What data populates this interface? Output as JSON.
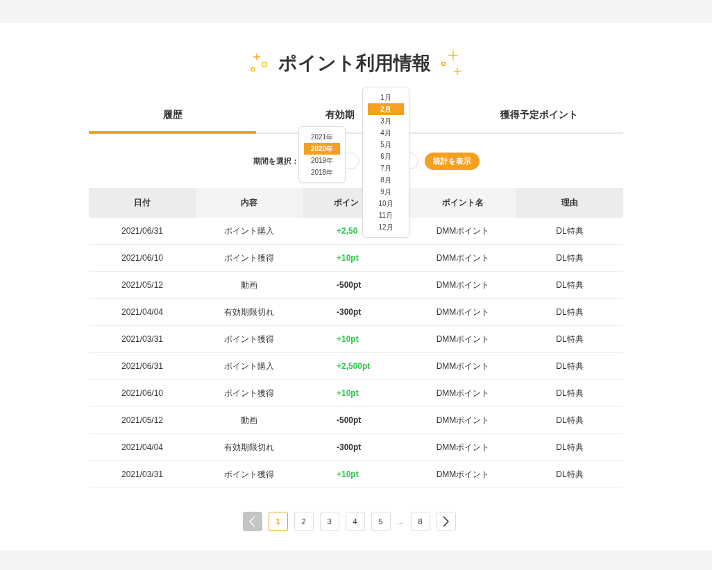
{
  "title": "ポイント利用情報",
  "tabs": [
    {
      "label": "履歴",
      "selected": true
    },
    {
      "label": "有効期",
      "selected": false
    },
    {
      "label": "獲得予定ポイント",
      "selected": false
    }
  ],
  "filter": {
    "label": "期間を選択：",
    "button": "統計を表示"
  },
  "year_dropdown": [
    {
      "label": "2021年",
      "selected": false
    },
    {
      "label": "2020年",
      "selected": true
    },
    {
      "label": "2019年",
      "selected": false
    },
    {
      "label": "2018年",
      "selected": false
    }
  ],
  "month_dropdown": [
    {
      "label": "1月",
      "selected": false
    },
    {
      "label": "2月",
      "selected": true
    },
    {
      "label": "3月",
      "selected": false
    },
    {
      "label": "4月",
      "selected": false
    },
    {
      "label": "5月",
      "selected": false
    },
    {
      "label": "6月",
      "selected": false
    },
    {
      "label": "7月",
      "selected": false
    },
    {
      "label": "8月",
      "selected": false
    },
    {
      "label": "9月",
      "selected": false
    },
    {
      "label": "10月",
      "selected": false
    },
    {
      "label": "11月",
      "selected": false
    },
    {
      "label": "12月",
      "selected": false
    }
  ],
  "table": {
    "columns": [
      "日付",
      "内容",
      "ポイン",
      "ポイント名",
      "理由"
    ],
    "rows": [
      {
        "date": "2021/06/31",
        "content": "ポイント購入",
        "points": "+2,50",
        "kind": "gain",
        "name": "DMMポイント",
        "reason": "DL特典"
      },
      {
        "date": "2021/06/10",
        "content": "ポイント獲得",
        "points": "+10pt",
        "kind": "gain",
        "name": "DMMポイント",
        "reason": "DL特典"
      },
      {
        "date": "2021/05/12",
        "content": "動画",
        "points": "-500pt",
        "kind": "use",
        "name": "DMMポイント",
        "reason": "DL特典"
      },
      {
        "date": "2021/04/04",
        "content": "有効期限切れ",
        "points": "-300pt",
        "kind": "use",
        "name": "DMMポイント",
        "reason": "DL特典"
      },
      {
        "date": "2021/03/31",
        "content": "ポイント獲得",
        "points": "+10pt",
        "kind": "gain",
        "name": "DMMポイント",
        "reason": "DL特典"
      },
      {
        "date": "2021/06/31",
        "content": "ポイント購入",
        "points": "+2,500pt",
        "kind": "gain",
        "name": "DMMポイント",
        "reason": "DL特典"
      },
      {
        "date": "2021/06/10",
        "content": "ポイント獲得",
        "points": "+10pt",
        "kind": "gain",
        "name": "DMMポイント",
        "reason": "DL特典"
      },
      {
        "date": "2021/05/12",
        "content": "動画",
        "points": "-500pt",
        "kind": "use",
        "name": "DMMポイント",
        "reason": "DL特典"
      },
      {
        "date": "2021/04/04",
        "content": "有効期限切れ",
        "points": "-300pt",
        "kind": "use",
        "name": "DMMポイント",
        "reason": "DL特典"
      },
      {
        "date": "2021/03/31",
        "content": "ポイント獲得",
        "points": "+10pt",
        "kind": "gain",
        "name": "DMMポイント",
        "reason": "DL特典"
      }
    ]
  },
  "pagination": {
    "prev_disabled": true,
    "pages": [
      {
        "label": "1",
        "selected": true
      },
      {
        "label": "2",
        "selected": false
      },
      {
        "label": "3",
        "selected": false
      },
      {
        "label": "4",
        "selected": false
      },
      {
        "label": "5",
        "selected": false
      },
      {
        "label": "…",
        "kind": "gap"
      },
      {
        "label": "8",
        "selected": false
      }
    ]
  }
}
